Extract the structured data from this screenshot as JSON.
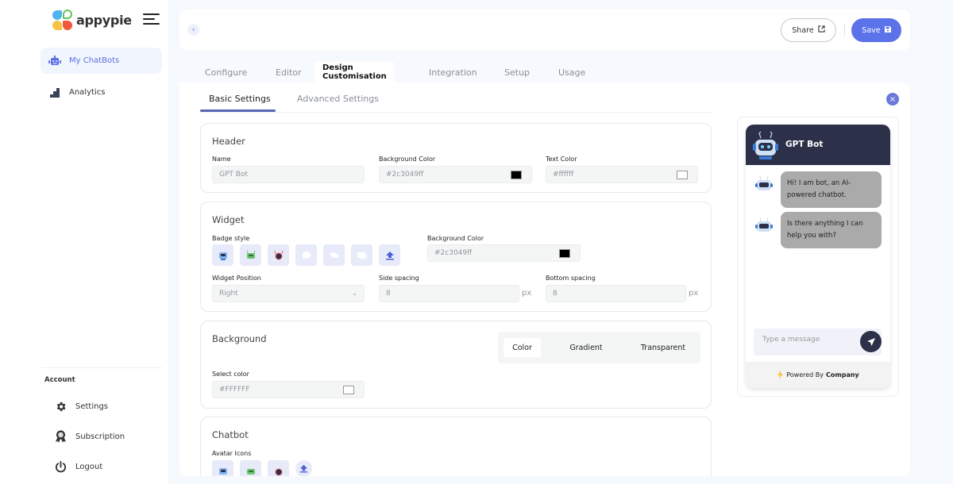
{
  "brand": {
    "name": "appypie"
  },
  "sidebar": {
    "items": [
      {
        "label": "My ChatBots",
        "icon": "robot-icon",
        "active": true
      },
      {
        "label": "Analytics",
        "icon": "bar-chart-icon",
        "active": false
      }
    ],
    "account_heading": "Account",
    "account_items": [
      {
        "label": "Settings",
        "icon": "gear-icon"
      },
      {
        "label": "Subscription",
        "icon": "badge-icon"
      },
      {
        "label": "Logout",
        "icon": "power-icon"
      }
    ]
  },
  "topbar": {
    "share_label": "Share",
    "save_label": "Save"
  },
  "tabs": [
    {
      "label": "Configure",
      "active": false
    },
    {
      "label": "Editor",
      "active": false
    },
    {
      "label": "Design Customisation",
      "active": true
    },
    {
      "label": "Integration",
      "active": false
    },
    {
      "label": "Setup",
      "active": false
    },
    {
      "label": "Usage",
      "active": false
    }
  ],
  "subtabs": [
    {
      "label": "Basic Settings",
      "active": true
    },
    {
      "label": "Advanced Settings",
      "active": false
    }
  ],
  "header_section": {
    "title": "Header",
    "name_label": "Name",
    "name_value": "GPT  Bot",
    "bg_color_label": "Background Color",
    "bg_color_value": "#2c3049ff",
    "bg_swatch": "#000000",
    "text_color_label": "Text Color",
    "text_color_value": "#ffffff",
    "text_swatch": "#ffffff"
  },
  "widget_section": {
    "title": "Widget",
    "badge_style_label": "Badge style",
    "badges": [
      "robot-blue-icon",
      "robot-green-icon",
      "robot-red-icon",
      "chat-bubble-icon",
      "chat-bubbles-icon",
      "chat-dots-icon",
      "upload-icon"
    ],
    "bg_color_label": "Background Color",
    "bg_color_value": "#2c3049ff",
    "bg_swatch": "#000000",
    "position_label": "Widget Position",
    "position_value": "Right",
    "side_spacing_label": "Side spacing",
    "side_spacing_value": "8",
    "bottom_spacing_label": "Bottom spacing",
    "bottom_spacing_value": "8",
    "unit": "px"
  },
  "background_section": {
    "title": "Background",
    "options": [
      {
        "label": "Color",
        "active": true
      },
      {
        "label": "Gradient",
        "active": false
      },
      {
        "label": "Transparent",
        "active": false
      }
    ],
    "select_color_label": "Select color",
    "color_value": "#FFFFFF",
    "swatch": "#ffffff"
  },
  "chatbot_section": {
    "title": "Chatbot",
    "avatar_label": "Avatar Icons",
    "avatars": [
      "robot-blue-icon",
      "robot-green-icon",
      "robot-red-icon",
      "upload-icon"
    ]
  },
  "preview": {
    "bot_name": "GPT Bot",
    "header_color": "#2c3049",
    "messages": [
      "Hi! I am bot, an AI-powered chatbot.",
      "Is there anything I can help you with?"
    ],
    "input_placeholder": "Type a message",
    "footer_prefix": "Powered By",
    "footer_company": "Company"
  },
  "colors": {
    "accent": "#5b72ea",
    "nav_active": "#5b6ee1"
  }
}
